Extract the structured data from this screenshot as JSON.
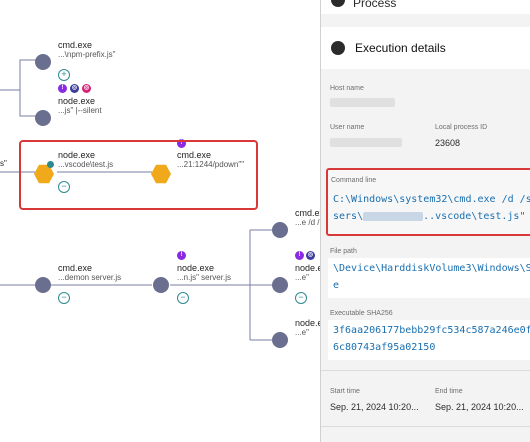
{
  "graph": {
    "top_node": {
      "name": "cmd.exe",
      "sub": "...\\npm-prefix.js\""
    },
    "node_silent": {
      "name": "node.exe",
      "sub": "...js\" |--silent"
    },
    "selected_node": {
      "name": "node.exe",
      "sub": "...vscode\\test.js"
    },
    "child_node": {
      "name": "cmd.exe",
      "sub": "...21:1244/pdown\"\""
    },
    "left_edge_text": "s\"",
    "demon_node": {
      "name": "cmd.exe",
      "sub": "...demon server.js"
    },
    "nodejs_node": {
      "name": "node.exe",
      "sub": "...n.js\" server.js"
    },
    "right_top_node": {
      "name": "cmd.exe",
      "sub": "...e /d /"
    },
    "right_mid_node": {
      "name": "node.e",
      "sub": "...e\""
    },
    "right_bottom_node": {
      "name": "node.e",
      "sub": "...e\""
    },
    "plus_symbol": "+",
    "minus_symbol": "−",
    "badge_colors": {
      "purple": "#8a2be2",
      "darkblue": "#3c3c9e",
      "pink": "#d4247a",
      "teal": "#2e8a8f"
    }
  },
  "panel": {
    "prev_section_title": "Process",
    "section_title": "Execution details",
    "host_label": "Host name",
    "user_label": "User name",
    "pid_label": "Local process ID",
    "pid_value": "23608",
    "cmd_label": "Command line",
    "cmd_line1": "C:\\Windows\\system32\\cmd.exe /d /s",
    "cmd_line2_a": "sers\\",
    "cmd_line2_b": "..vscode\\test.js\"",
    "path_label": "File path",
    "path_line1": "\\Device\\HarddiskVolume3\\Windows\\Sy",
    "path_line2": "e",
    "sha_label": "Executable SHA256",
    "sha_line1": "3f6aa206177bebb29fc534c587a246e0f3",
    "sha_line2": "6c80743af95a02150",
    "start_label": "Start time",
    "start_value": "Sep. 21, 2024 10:20...",
    "end_label": "End time",
    "end_value": "Sep. 21, 2024 10:20..."
  }
}
